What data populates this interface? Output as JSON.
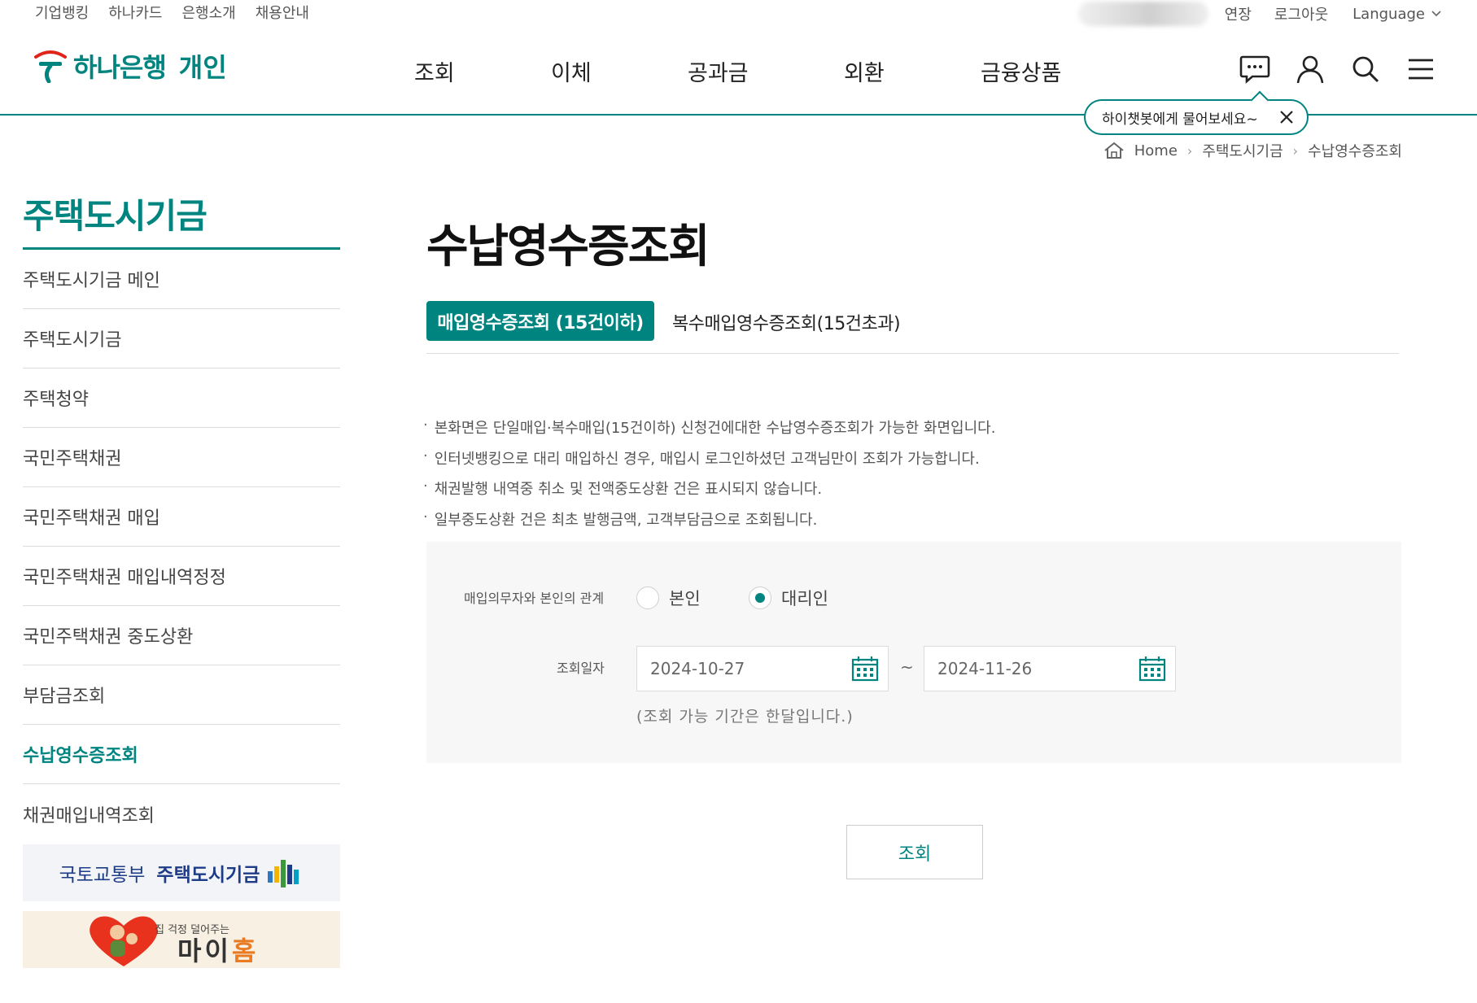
{
  "util_bar": {
    "links": [
      "기업뱅킹",
      "하나카드",
      "은행소개",
      "채용안내"
    ],
    "extend": "연장",
    "logout": "로그아웃",
    "language": "Language"
  },
  "header": {
    "logo_text": "하나은행",
    "logo_sub": "개인",
    "nav": [
      "조회",
      "이체",
      "공과금",
      "외환",
      "금융상품"
    ],
    "icons": [
      "chatbot-icon",
      "user-icon",
      "search-icon",
      "menu-icon"
    ]
  },
  "chat_bubble": {
    "text": "하이챗봇에게 물어보세요~"
  },
  "breadcrumb": {
    "home": "Home",
    "level1": "주택도시기금",
    "level2": "수납영수증조회"
  },
  "sidebar": {
    "title": "주택도시기금",
    "items": [
      "주택도시기금 메인",
      "주택도시기금",
      "주택청약",
      "국민주택채권",
      "국민주택채권 매입",
      "국민주택채권 매입내역정정",
      "국민주택채권 중도상환",
      "부담금조회",
      "수납영수증조회",
      "채권매입내역조회"
    ],
    "banner1": {
      "left": "국토교통부",
      "right": "주택도시기금"
    },
    "banner2": {
      "small": "집 걱정 덜어주는",
      "big": "마이",
      "big_accent": "홈"
    }
  },
  "main": {
    "title": "수납영수증조회",
    "tabs": [
      "매입영수증조회 (15건이하)",
      "복수매입영수증조회(15건초과)"
    ],
    "notices": [
      "본화면은 단일매입·복수매입(15건이하) 신청건에대한 수납영수증조회가 가능한 화면입니다.",
      "인터넷뱅킹으로 대리 매입하신 경우, 매입시 로그인하셨던 고객님만이 조회가 가능합니다.",
      "채권발행 내역중 취소 및 전액중도상환 건은 표시되지 않습니다.",
      "일부중도상환 건은 최초 발행금액, 고객부담금으로 조회됩니다."
    ],
    "form": {
      "relation_label": "매입의무자와 본인의 관계",
      "radio_self": "본인",
      "radio_agent": "대리인",
      "date_label": "조회일자",
      "start_date": "2024-10-27",
      "end_date": "2024-11-26",
      "tilde": "~",
      "period_note": "(조회 가능 기간은 한달입니다.)"
    },
    "search_button": "조회"
  },
  "colors": {
    "brand": "#00847f",
    "text": "#333333",
    "form_bg": "#f7f7f7"
  }
}
